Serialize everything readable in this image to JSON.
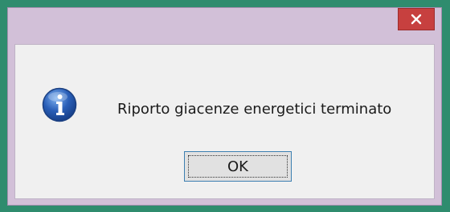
{
  "dialog": {
    "message": "Riporto giacenze energetici terminato",
    "ok_label": "OK",
    "close_glyph": "×",
    "icon": "info-icon"
  },
  "colors": {
    "desktop_background": "#2f8c6e",
    "window_frame": "#d2c0d8",
    "close_button": "#c7403f",
    "content_background": "#f0f0f0",
    "ok_button_border": "#3c7fb1",
    "info_icon_blue": "#2a5fb8"
  }
}
